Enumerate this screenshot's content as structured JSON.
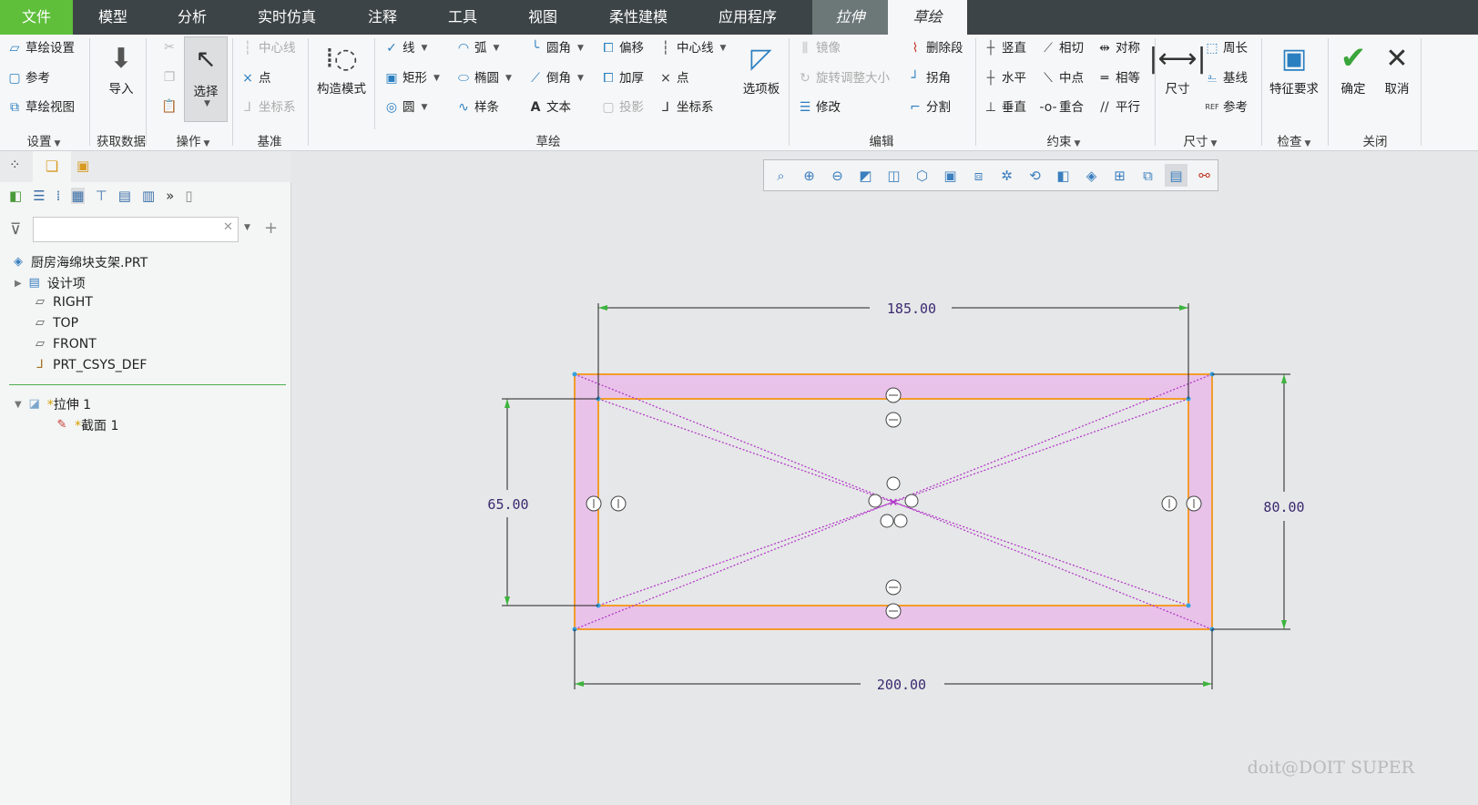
{
  "tabs": [
    "文件",
    "模型",
    "分析",
    "实时仿真",
    "注释",
    "工具",
    "视图",
    "柔性建模",
    "应用程序",
    "拉伸",
    "草绘"
  ],
  "ribbon": {
    "setup": {
      "items": [
        "草绘设置",
        "参考",
        "草绘视图"
      ],
      "label": "设置"
    },
    "getdata": {
      "import": "导入",
      "label": "获取数据"
    },
    "ops": {
      "select": "选择",
      "label": "操作"
    },
    "datum": {
      "items": [
        "中心线",
        "点",
        "坐标系"
      ],
      "label": "基准"
    },
    "construct": "构造模式",
    "sketch": {
      "items": [
        "线",
        "弧",
        "圆角",
        "偏移",
        "中心线",
        "矩形",
        "椭圆",
        "倒角",
        "加厚",
        "点",
        "圆",
        "样条",
        "文本",
        "投影",
        "坐标系"
      ],
      "palette": "选项板",
      "label": "草绘"
    },
    "edit": {
      "items": [
        "镜像",
        "旋转调整大小",
        "修改",
        "删除段",
        "拐角",
        "分割"
      ],
      "label": "编辑"
    },
    "constrain": {
      "items": [
        "竖直",
        "相切",
        "对称",
        "水平",
        "中点",
        "相等",
        "垂直",
        "重合",
        "平行"
      ],
      "label": "约束"
    },
    "dimension": {
      "big": "尺寸",
      "items": [
        "周长",
        "基线",
        "参考"
      ],
      "label": "尺寸"
    },
    "inspect": {
      "big": "特征要求",
      "label": "检查"
    },
    "close": {
      "ok": "确定",
      "cancel": "取消",
      "label": "关闭"
    }
  },
  "tree": {
    "filter_value": "",
    "root": "厨房海绵块支架.PRT",
    "items": [
      "设计项",
      "RIGHT",
      "TOP",
      "FRONT",
      "PRT_CSYS_DEF"
    ],
    "feature": "拉伸 1",
    "section": "截面 1",
    "new_mark": "*"
  },
  "sketch": {
    "dims": {
      "top": "185.00",
      "bottom": "200.00",
      "left": "65.00",
      "right": "80.00"
    }
  },
  "watermark": "doit@DOIT SUPER",
  "colors": {
    "file_tab": "#5fbf3b",
    "sketch_fill": "#e8c2e8",
    "sketch_line": "#f39c2b"
  }
}
